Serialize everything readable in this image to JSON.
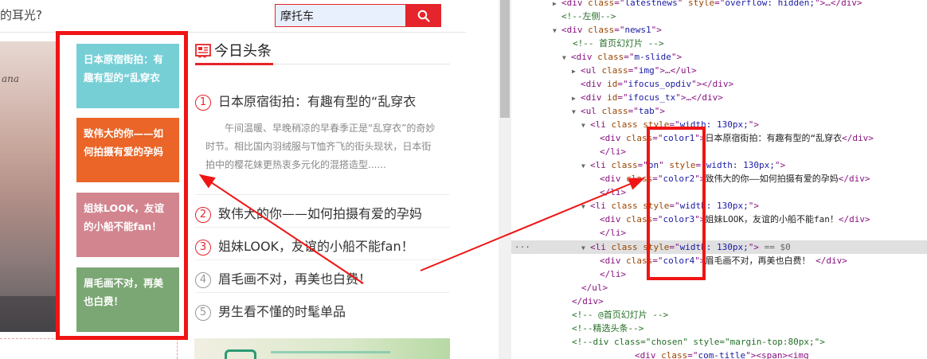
{
  "page": {
    "top_question": "的耳光?",
    "search": {
      "value": "摩托车",
      "icon": "search-icon"
    },
    "slide_script_text": "ana",
    "tabs": [
      {
        "label": "日本原宿街拍：有趣有型的“乱穿衣",
        "color": "#77cfd6"
      },
      {
        "label": "致伟大的你——如何拍摄有爱的孕妈",
        "color": "#ea6527"
      },
      {
        "label": "姐妹LOOK，友谊的小船不能fan！",
        "color": "#d3858f"
      },
      {
        "label": "眉毛画不对，再美也白费！",
        "color": "#7ba774"
      }
    ],
    "news": {
      "title": "今日头条",
      "icon": "newspaper-icon",
      "accent": "#e5242b",
      "headlines": [
        {
          "num": "1",
          "text": "日本原宿街拍：有趣有型的“乱穿衣"
        },
        {
          "num": "2",
          "text": "致伟大的你——如何拍摄有爱的孕妈"
        },
        {
          "num": "3",
          "text": "姐妹LOOK，友谊的小船不能fan！"
        },
        {
          "num": "4",
          "text": "眉毛画不对，再美也白费！"
        },
        {
          "num": "5",
          "text": "男生看不懂的时髦单品"
        }
      ],
      "summary": "午间温暖、早晚稍凉的早春季正是“乱穿衣”的奇妙时节。相比国内羽绒服与T恤齐飞的街头现状，日本街拍中的樱花妹更热衷多元化的混搭造型......"
    }
  },
  "devtools": {
    "selected_suffix": "== $0",
    "l01": {
      "tag_open": "<div ",
      "attr": "class",
      "eq": "=\"",
      "val": "latestnews",
      "mid": "\" ",
      "attr2": "style",
      "eq2": "=\"",
      "val2": "overflow: hidden;",
      "close": "\">…</div>"
    },
    "l02": "<!--左侧-->",
    "l03": {
      "tag_open": "<div ",
      "attr": "class",
      "eq": "=\"",
      "val": "news1",
      "close": "\">"
    },
    "l04": "<!-- 首页幻灯片 -->",
    "l05": {
      "tag_open": "<div ",
      "attr": "class",
      "eq": "=\"",
      "val": "m-slide",
      "close": "\">"
    },
    "l06": {
      "tag_open": "<ul ",
      "attr": "class",
      "eq": "=\"",
      "val": "img",
      "close": "\">…</ul>"
    },
    "l07": {
      "tag_open": "<div ",
      "attr": "id",
      "eq": "=\"",
      "val": "ifocus_opdiv",
      "close": "\"></div>"
    },
    "l08": {
      "tag_open": "<div ",
      "attr": "id",
      "eq": "=\"",
      "val": "ifocus_tx",
      "close": "\">…</div>"
    },
    "l09": {
      "tag_open": "<ul ",
      "attr": "class",
      "eq": "=\"",
      "val": "tab",
      "close": "\">"
    },
    "l10": {
      "tag_open": "<li ",
      "attr": "class",
      "mid": " ",
      "attr2": "style",
      "eq2": "=\"",
      "val2": "width: 130px;",
      "close": "\">"
    },
    "l11": {
      "tag_open": "<div ",
      "attr": "class",
      "eq": "=\"",
      "val": "color1",
      "mid": "\">",
      "text": "日本原宿街拍：有趣有型的“乱穿衣",
      "close": "</div>"
    },
    "l12": "</li>",
    "l13": {
      "tag_open": "<li ",
      "attr": "class",
      "eq": "=\"",
      "val": "on",
      "mid": "\" ",
      "attr2": "style",
      "eq2": "=\"",
      "val2": "width: 130px;",
      "close": "\">"
    },
    "l14": {
      "tag_open": "<div ",
      "attr": "class",
      "eq": "=\"",
      "val": "color2",
      "mid": "\">",
      "text": "致伟大的你——如何拍摄有爱的孕妈",
      "close": "</div>"
    },
    "l15": "</li>",
    "l16": {
      "tag_open": "<li ",
      "attr": "class",
      "mid": " ",
      "attr2": "style",
      "eq2": "=\"",
      "val2": "width: 130px;",
      "close": "\">"
    },
    "l17": {
      "tag_open": "<div ",
      "attr": "class",
      "eq": "=\"",
      "val": "color3",
      "mid": "\">",
      "text": "姐妹LOOK，友谊的小船不能fan！",
      "close": "</div>"
    },
    "l18": "</li>",
    "l19": {
      "tag_open": "<li ",
      "attr": "class",
      "mid": " ",
      "attr2": "style",
      "eq2": "=\"",
      "val2": "width: 130px;",
      "close": "\">"
    },
    "l20": {
      "tag_open": "<div ",
      "attr": "class",
      "eq": "=\"",
      "val": "color4",
      "mid": "\">",
      "text": "眉毛画不对，再美也白费！ ",
      "close": "</div>"
    },
    "l21": "</li>",
    "l22": "</ul>",
    "l23": "</div>",
    "l24": "<!-- @首页幻灯片 -->",
    "l25": "<!--精选头条-->",
    "l26": "<!--div class=\"chosen\" style=\"margin-top:80px;\">",
    "l27": {
      "tag_open": "<div ",
      "attr": "class",
      "eq": "=\"",
      "val": "com-title",
      "close": "\"><span><img"
    }
  }
}
